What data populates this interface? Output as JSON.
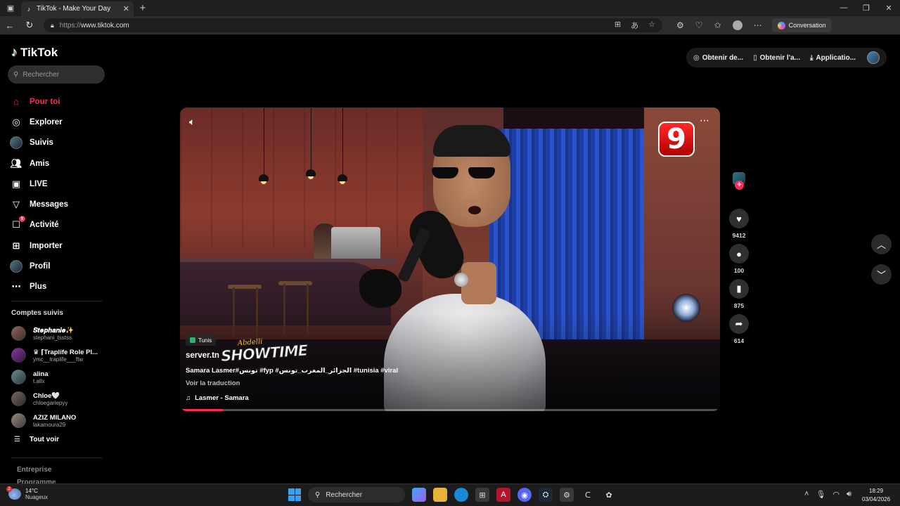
{
  "browser": {
    "tab_title": "TikTok - Make Your Day",
    "url_protocol": "https://",
    "url_host": "www.tiktok.com",
    "conversation_label": "Conversation"
  },
  "brand": {
    "name": "TikTok"
  },
  "search": {
    "placeholder": "Rechercher"
  },
  "nav": [
    {
      "label": "Pour toi",
      "icon": "home-icon",
      "active": true
    },
    {
      "label": "Explorer",
      "icon": "compass-icon"
    },
    {
      "label": "Suivis",
      "icon": "following-avatar-icon"
    },
    {
      "label": "Amis",
      "icon": "friends-icon"
    },
    {
      "label": "LIVE",
      "icon": "live-icon"
    },
    {
      "label": "Messages",
      "icon": "messages-icon"
    },
    {
      "label": "Activité",
      "icon": "activity-icon",
      "badge": "9"
    },
    {
      "label": "Importer",
      "icon": "upload-icon"
    },
    {
      "label": "Profil",
      "icon": "profile-icon"
    },
    {
      "label": "Plus",
      "icon": "more-icon"
    }
  ],
  "following": {
    "title": "Comptes suivis",
    "accounts": [
      {
        "name": "𝑺𝒕𝒆𝒑𝒉𝒂𝒏𝒊𝒆✨",
        "handle": "stephani_tsstss"
      },
      {
        "name": "♛ ⌈Traplife Role Pl...",
        "handle": "ymc__traplife___ftw"
      },
      {
        "name": "alina",
        "handle": "t.allx"
      },
      {
        "name": "Chloe🤍",
        "handle": "chloegariepyy"
      },
      {
        "name": "AZIZ MILANO",
        "handle": "lakamoura29"
      }
    ],
    "see_all": "Tout voir"
  },
  "footer": {
    "line1": "Entreprise",
    "line2": "Programme"
  },
  "header": {
    "get_coins": "Obtenir de...",
    "get_app": "Obtenir l'a...",
    "desktop_app": "Applicatio..."
  },
  "video": {
    "location": "Tunis",
    "author": "server.tn",
    "overlay_small": "Abdelli",
    "overlay_big": "SHOWTIME",
    "channel_logo": "9",
    "caption": "Samara Lasmer#تونس #fyp #الجزائر_المغرب_تونس #tunisia #viral",
    "translate": "Voir la traduction",
    "music": "Lasmer - Samara",
    "progress": 0.08
  },
  "actions": {
    "likes": "9412",
    "comments": "100",
    "saves": "875",
    "shares": "614"
  },
  "taskbar": {
    "temperature": "14°C",
    "weather": "Nuageux",
    "weather_badge": "2",
    "search_label": "Rechercher",
    "time": "18:29",
    "date": "03/04/2026"
  }
}
